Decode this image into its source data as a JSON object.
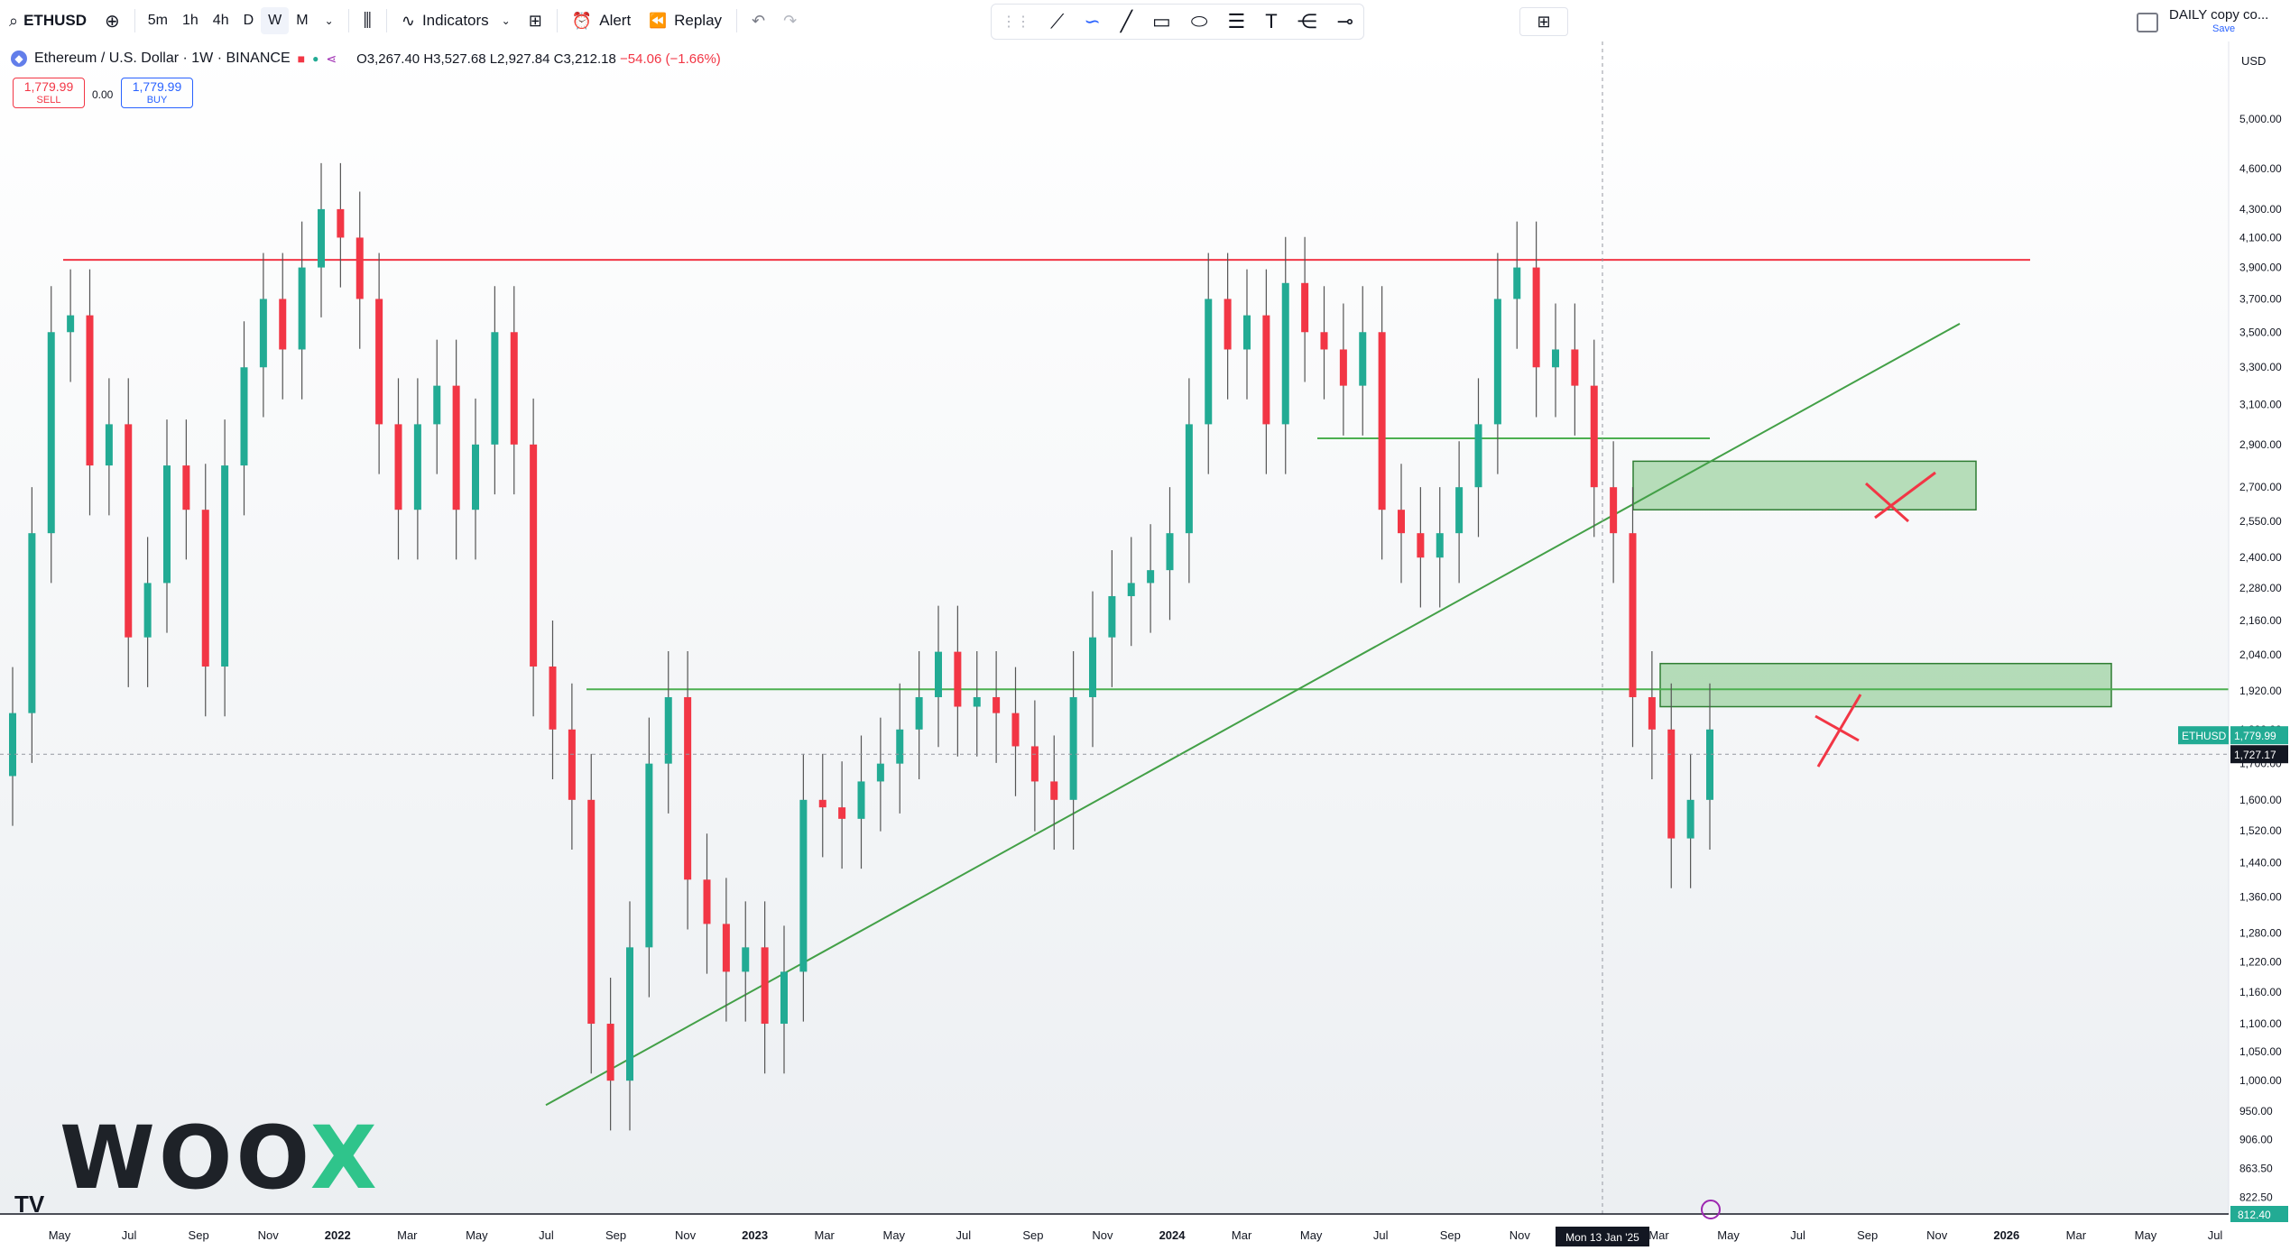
{
  "toolbar": {
    "symbol": "ETHUSD",
    "timeframes": [
      "5m",
      "1h",
      "4h",
      "D",
      "W",
      "M"
    ],
    "active_timeframe": "W",
    "indicators_label": "Indicators",
    "alert_label": "Alert",
    "replay_label": "Replay",
    "daily_label": "DAILY copy co...",
    "daily_sub": "Save"
  },
  "legend": {
    "title": "Ethereum / U.S. Dollar · 1W · BINANCE",
    "open": "O3,267.40",
    "high": "H3,527.68",
    "low": "L2,927.84",
    "close": "C3,212.18",
    "change": "−54.06 (−1.66%)"
  },
  "trade": {
    "sell_price": "1,779.99",
    "sell_label": "SELL",
    "spread": "0.00",
    "buy_price": "1,779.99",
    "buy_label": "BUY"
  },
  "chart_data": {
    "type": "candlestick",
    "symbol_tag": "ETHUSD",
    "currency": "USD",
    "last_price": "1,779.99",
    "crosshair_price": "1,727.17",
    "low_marker_price": "812.40",
    "crosshair_date": "Mon 13 Jan '25",
    "price_ticks": [
      "5,000.00",
      "4,600.00",
      "4,300.00",
      "4,100.00",
      "3,900.00",
      "3,700.00",
      "3,500.00",
      "3,300.00",
      "3,100.00",
      "2,900.00",
      "2,700.00",
      "2,550.00",
      "2,400.00",
      "2,280.00",
      "2,160.00",
      "2,040.00",
      "1,920.00",
      "1,800.00",
      "1,700.00",
      "1,600.00",
      "1,520.00",
      "1,440.00",
      "1,360.00",
      "1,280.00",
      "1,220.00",
      "1,160.00",
      "1,100.00",
      "1,050.00",
      "1,000.00",
      "950.00",
      "906.00",
      "863.50",
      "822.50"
    ],
    "time_ticks": [
      "May",
      "Jul",
      "Sep",
      "Nov",
      "2022",
      "Mar",
      "May",
      "Jul",
      "Sep",
      "Nov",
      "2023",
      "Mar",
      "May",
      "Jul",
      "Sep",
      "Nov",
      "2024",
      "Mar",
      "May",
      "Jul",
      "Sep",
      "Nov",
      "Mar",
      "May",
      "Jul",
      "Sep",
      "Nov",
      "2026",
      "Mar",
      "May",
      "Jul"
    ],
    "levels": [
      {
        "name": "resistance",
        "price": 3950,
        "color": "#f23645"
      },
      {
        "name": "neckline",
        "price": 2930,
        "color": "#4caf50"
      },
      {
        "name": "support",
        "price": 1925,
        "color": "#4caf50"
      }
    ],
    "zones": [
      {
        "name": "upper-zone",
        "price_top": 2820,
        "price_bottom": 2600,
        "color": "#4caf50"
      },
      {
        "name": "lower-zone",
        "price_top": 2010,
        "price_bottom": 1870,
        "color": "#4caf50"
      }
    ],
    "trendline": {
      "from_price": 960,
      "to_price": 3550
    },
    "closes": [
      1850,
      2500,
      3500,
      3600,
      2800,
      3000,
      2100,
      2300,
      2800,
      2600,
      2000,
      2800,
      3300,
      3700,
      3400,
      3900,
      4300,
      4100,
      3700,
      3000,
      2600,
      3000,
      3200,
      2600,
      2900,
      3500,
      2900,
      2000,
      1800,
      1600,
      1100,
      1000,
      1250,
      1700,
      1900,
      1400,
      1300,
      1200,
      1250,
      1100,
      1200,
      1600,
      1580,
      1550,
      1650,
      1700,
      1800,
      1900,
      2050,
      1870,
      1900,
      1850,
      1750,
      1650,
      1600,
      1900,
      2100,
      2250,
      2300,
      2350,
      2500,
      3000,
      3700,
      3400,
      3600,
      3000,
      3800,
      3500,
      3400,
      3200,
      3500,
      2600,
      2500,
      2400,
      2500,
      2700,
      3000,
      3700,
      3900,
      3300,
      3400,
      3200,
      2700,
      2500,
      1900,
      1800,
      1500,
      1600,
      1800
    ]
  },
  "branding": {
    "woox_left": "WOO",
    "woox_right": "X",
    "tv": "TV"
  },
  "colors": {
    "up": "#22ab94",
    "down": "#f23645",
    "zone_fill": "#66bb6a"
  }
}
